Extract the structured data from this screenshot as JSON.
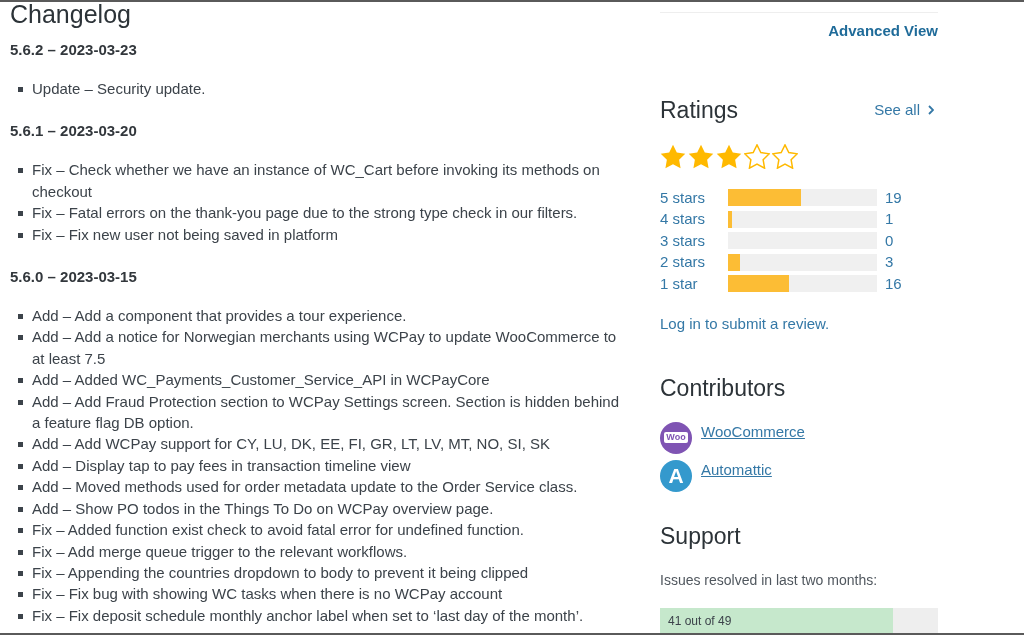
{
  "changelog": {
    "title": "Changelog",
    "releases": [
      {
        "version": "5.6.2 – 2023-03-23",
        "entries": [
          "Update – Security update."
        ]
      },
      {
        "version": "5.6.1 – 2023-03-20",
        "entries": [
          "Fix – Check whether we have an instance of WC_Cart before invoking its methods on checkout",
          "Fix – Fatal errors on the thank-you page due to the strong type check in our filters.",
          "Fix – Fix new user not being saved in platform"
        ]
      },
      {
        "version": "5.6.0 – 2023-03-15",
        "entries": [
          "Add – Add a component that provides a tour experience.",
          "Add – Add a notice for Norwegian merchants using WCPay to update WooCommerce to at least 7.5",
          "Add – Added WC_Payments_Customer_Service_API in WCPayCore",
          "Add – Add Fraud Protection section to WCPay Settings screen. Section is hidden behind a feature flag DB option.",
          "Add – Add WCPay support for CY, LU, DK, EE, FI, GR, LT, LV, MT, NO, SI, SK",
          "Add – Display tap to pay fees in transaction timeline view",
          "Add – Moved methods used for order metadata update to the Order Service class.",
          "Add – Show PO todos in the Things To Do on WCPay overview page.",
          "Fix – Added function exist check to avoid fatal error for undefined function.",
          "Fix – Add merge queue trigger to the relevant workflows.",
          "Fix – Appending the countries dropdown to body to prevent it being clipped",
          "Fix – Fix bug with showing WC tasks when there is no WCPay account",
          "Fix – Fix deposit schedule monthly anchor label when set to ‘last day of the month’."
        ]
      }
    ]
  },
  "sidebar": {
    "advanced_view_link": "Advanced View",
    "ratings": {
      "title": "Ratings",
      "see_all_link": "See all",
      "stars": 3,
      "breakdown": [
        {
          "label": "5 stars",
          "level": 0.49,
          "count": "19"
        },
        {
          "label": "4 stars",
          "level": 0.03,
          "count": "1"
        },
        {
          "label": "3 stars",
          "count": "0"
        },
        {
          "label": "2 stars",
          "level": 0.08,
          "count": "3"
        },
        {
          "label": "1 star",
          "level": 0.41,
          "count": "16"
        }
      ],
      "review_link": "Log in to submit a review."
    },
    "contributors": {
      "title": "Contributors",
      "people": [
        {
          "kind": "woo",
          "logo_text": "Woo",
          "name": "WooCommerce"
        },
        {
          "kind": "automattic",
          "logo_text": "A",
          "name": "Automattic"
        }
      ]
    },
    "support": {
      "title": "Support",
      "caption": "Issues resolved in last two months:",
      "resolved": {
        "label": "41 out of 49",
        "level": 0.837
      }
    }
  }
}
